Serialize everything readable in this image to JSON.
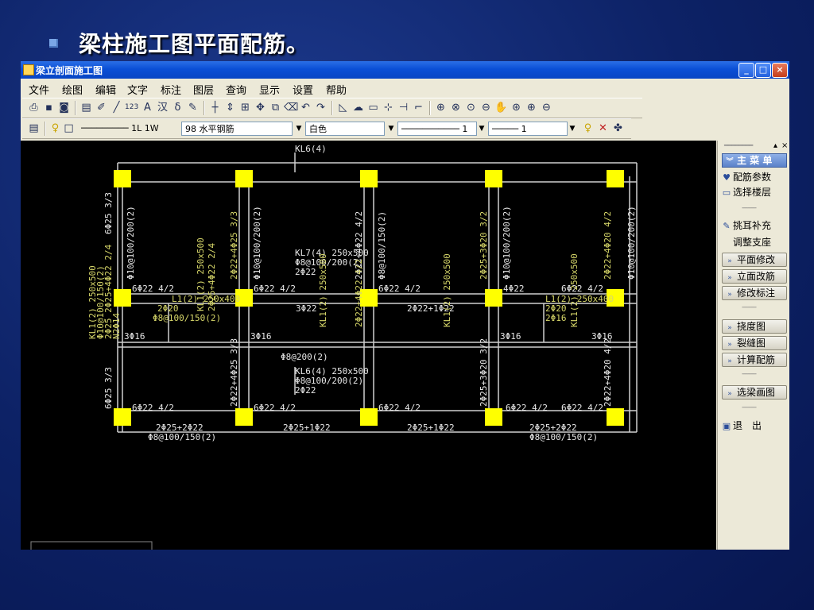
{
  "slide": {
    "title": "梁柱施工图平面配筋。"
  },
  "window": {
    "title": "梁立剖面施工图",
    "min_label": "_",
    "max_label": "□",
    "close_label": "×"
  },
  "menu": [
    "文件",
    "绘图",
    "编辑",
    "文字",
    "标注",
    "图层",
    "查询",
    "显示",
    "设置",
    "帮助"
  ],
  "toolbar2": {
    "layer_field": "───────── 1L 1W",
    "layer_name": "98 水平钢筋",
    "color_value": "白色",
    "linetype_value": "─────────── 1",
    "lineweight_value": "───── 1"
  },
  "drawing": {
    "top_label": "KL6(4)",
    "labels": {
      "kl7": "KL7(4) 250x500",
      "kl7_stirrup": "Φ8@100/200(2)",
      "kl7_top": "2Φ22",
      "kl6_lower": "KL6(4) 250x500",
      "kl6_lower_stirrup": "Φ8@100/200(2)",
      "kl6_lower_top": "2Φ22",
      "s1": "6Φ22 4/2",
      "s2": "6Φ22 4/2",
      "s3": "6Φ22 4/2",
      "s4": "4Φ22",
      "s5": "6Φ22 4/2",
      "s6": "6Φ22 4/2",
      "s7": "6Φ22 4/2",
      "s8": "6Φ22 4/2",
      "s9": "6Φ22 4/2",
      "s10": "6Φ22 4/2",
      "m1": "3Φ22",
      "m2": "2Φ22+1Φ22",
      "t1": "3Φ16",
      "t2": "3Φ16",
      "t3": "3Φ16",
      "t4": "3Φ16",
      "mid_stirrup": "Φ8@200(2)",
      "b1": "2Φ25+2Φ22",
      "b2": "2Φ25+1Φ22",
      "b3": "2Φ25+1Φ22",
      "b4": "2Φ25+2Φ22",
      "b1s": "Φ8@100/150(2)",
      "b4s": "Φ8@100/150(2)",
      "v1": "6Φ25 3/3",
      "v2": "6Φ25 3/3",
      "v3": "Φ10@100/200(2)",
      "v4": "2Φ22+4Φ25 3/3",
      "v5": "Φ10@100/200(2)",
      "v6": "2Φ22+4Φ22 4/2",
      "v7": "Φ8@100/150(2)",
      "v8": "2Φ25+3Φ20 3/2",
      "v9": "Φ10@100/200(2)",
      "v10": "2Φ22+4Φ20 4/2",
      "v11": "Φ10@100/200(2)",
      "v12": "2Φ25+4Φ22 2/4",
      "v13": "2Φ22+4Φ25 3/3",
      "v14": "2Φ22+4Φ22 4/2",
      "v15": "2Φ25+3Φ20 3/2",
      "v16": "2Φ22+4Φ20 4/2",
      "kl1": "KL1(2) 250x500",
      "kl1b": "Φ10@100/150(2)",
      "kl1c": "2Φ25 2Φ25+4Φ22 2/4",
      "kl1d": "N2Φ14",
      "l1": "L1(2) 250x400",
      "l1b": "2Φ20",
      "l1c": "Φ8@100/150(2)",
      "l1d": "2Φ16"
    }
  },
  "sidepanel": {
    "header": "主 菜 单",
    "items": [
      {
        "label": "配筋参数",
        "icon": "paint-icon"
      },
      {
        "label": "选择楼层",
        "icon": "document-icon"
      },
      {
        "label": "挑耳补充",
        "icon": "pencil-icon"
      },
      {
        "label": "调整支座",
        "icon": ""
      }
    ],
    "buttons": [
      "平面修改",
      "立面改筋",
      "修改标注",
      "挠度图",
      "裂缝图",
      "计算配筋",
      "选梁画图"
    ],
    "exit": "退　出"
  }
}
